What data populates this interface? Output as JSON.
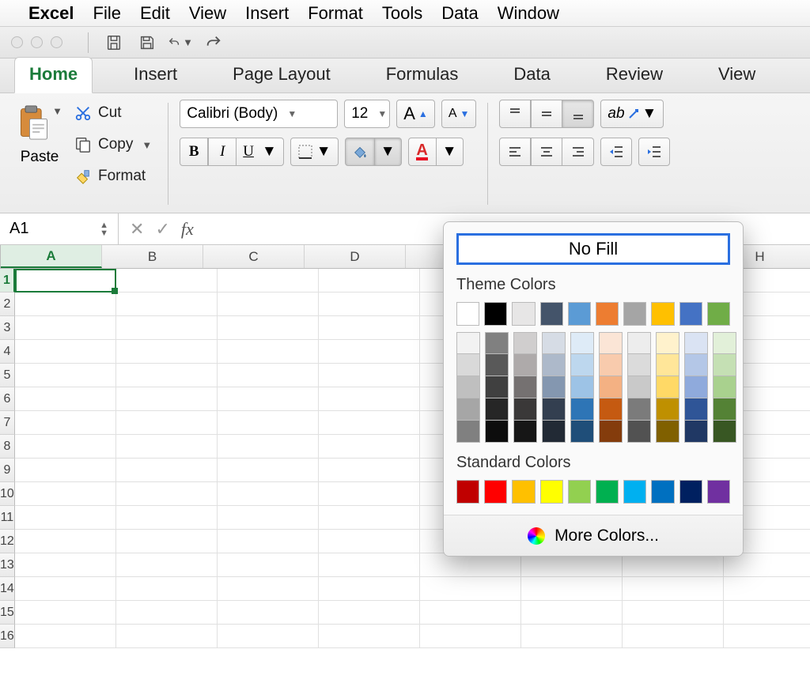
{
  "mac_menu": {
    "app": "Excel",
    "items": [
      "File",
      "Edit",
      "View",
      "Insert",
      "Format",
      "Tools",
      "Data",
      "Window"
    ]
  },
  "ribbon_tabs": [
    "Home",
    "Insert",
    "Page Layout",
    "Formulas",
    "Data",
    "Review",
    "View"
  ],
  "active_tab": "Home",
  "clipboard": {
    "paste": "Paste",
    "cut": "Cut",
    "copy": "Copy",
    "format": "Format"
  },
  "font": {
    "name": "Calibri (Body)",
    "size": "12"
  },
  "formula_bar": {
    "cell_ref": "A1",
    "fx": "fx",
    "value": ""
  },
  "columns": [
    "A",
    "B",
    "C",
    "D",
    "",
    "",
    "",
    "H"
  ],
  "rows": [
    1,
    2,
    3,
    4,
    5,
    6,
    7,
    8,
    9,
    10,
    11,
    12,
    13,
    14,
    15,
    16
  ],
  "selected_cell": "A1",
  "color_picker": {
    "no_fill": "No Fill",
    "theme_label": "Theme Colors",
    "standard_label": "Standard Colors",
    "more": "More Colors...",
    "theme_base": [
      "#ffffff",
      "#000000",
      "#e7e6e6",
      "#44546a",
      "#5b9bd5",
      "#ed7d31",
      "#a5a5a5",
      "#ffc000",
      "#4472c4",
      "#70ad47"
    ],
    "theme_shades": [
      [
        "#f2f2f2",
        "#d9d9d9",
        "#bfbfbf",
        "#a6a6a6",
        "#808080"
      ],
      [
        "#808080",
        "#595959",
        "#404040",
        "#262626",
        "#0d0d0d"
      ],
      [
        "#d0cece",
        "#aeaaaa",
        "#757171",
        "#3a3838",
        "#161616"
      ],
      [
        "#d6dce5",
        "#adb9ca",
        "#8497b0",
        "#333f50",
        "#222a35"
      ],
      [
        "#deebf7",
        "#bdd7ee",
        "#9dc3e6",
        "#2e75b6",
        "#1f4e79"
      ],
      [
        "#fbe5d6",
        "#f8cbad",
        "#f4b183",
        "#c55a11",
        "#843c0c"
      ],
      [
        "#ededed",
        "#dbdbdb",
        "#c9c9c9",
        "#7b7b7b",
        "#525252"
      ],
      [
        "#fff2cc",
        "#ffe699",
        "#ffd966",
        "#bf9000",
        "#806000"
      ],
      [
        "#dae3f3",
        "#b4c7e7",
        "#8faadc",
        "#2f5597",
        "#203864"
      ],
      [
        "#e2f0d9",
        "#c5e0b4",
        "#a9d18e",
        "#548235",
        "#385723"
      ]
    ],
    "standard": [
      "#c00000",
      "#ff0000",
      "#ffc000",
      "#ffff00",
      "#92d050",
      "#00b050",
      "#00b0f0",
      "#0070c0",
      "#002060",
      "#7030a0"
    ]
  }
}
